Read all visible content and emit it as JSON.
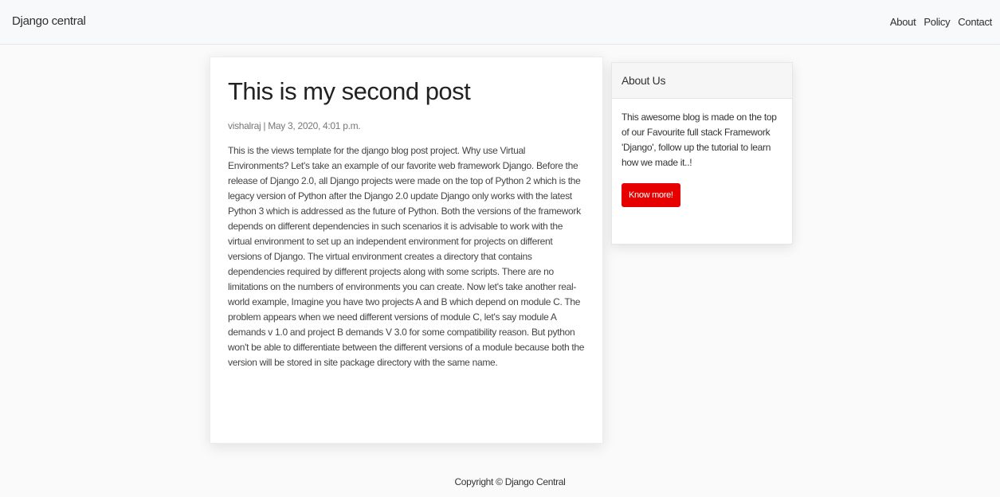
{
  "navbar": {
    "brand": "Django central",
    "links": [
      "About",
      "Policy",
      "Contact"
    ]
  },
  "post": {
    "title": "This is my second post",
    "meta": "vishalraj | May 3, 2020, 4:01 p.m.",
    "body": "This is the views template for the django blog post project. Why use Virtual Environments? Let's take an example of our favorite web framework Django. Before the release of Django 2.0, all Django projects were made on the top of Python 2 which is the legacy version of Python after the Django 2.0 update Django only works with the latest Python 3 which is addressed as the future of Python. Both the versions of the framework depends on different dependencies in such scenarios it is advisable to work with the virtual environment to set up an independent environment for projects on different versions of Django. The virtual environment creates a directory that contains dependencies required by different projects along with some scripts. There are no limitations on the numbers of environments you can create. Now let's take another real-world example, Imagine you have two projects A and B which depend on module C. The problem appears when we need different versions of module C, let's say module A demands v 1.0 and project B demands V 3.0 for some compatibility reason. But python won't be able to differentiate between the different versions of a module because both the version will be stored in site package directory with the same name."
  },
  "sidebar": {
    "title": "About Us",
    "text": "This awesome blog is made on the top of our Favourite full stack Framework 'Django', follow up the tutorial to learn how we made it..!",
    "button_label": "Know more!",
    "button_color": "#e60000"
  },
  "footer": {
    "text": "Copyright © Django Central"
  }
}
